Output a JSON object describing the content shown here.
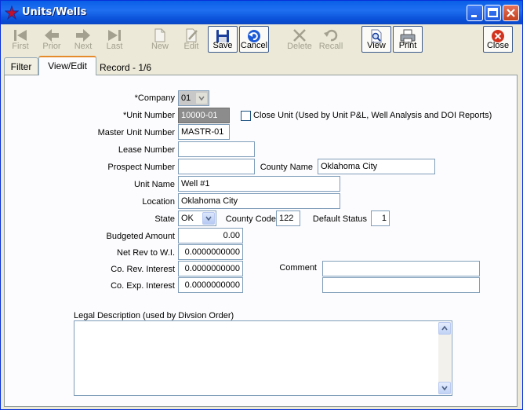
{
  "window": {
    "title": "Units/Wells"
  },
  "toolbar": {
    "first": "First",
    "prior": "Prior",
    "next": "Next",
    "last": "Last",
    "new": "New",
    "edit": "Edit",
    "save": "Save",
    "cancel": "Cancel",
    "delete": "Delete",
    "recall": "Recall",
    "view": "View",
    "print": "Print",
    "close": "Close"
  },
  "tabs": {
    "filter": "Filter",
    "view_edit": "View/Edit",
    "record_count": "Record - 1/6"
  },
  "form": {
    "company": {
      "label": "*Company",
      "value": "01"
    },
    "unit_number": {
      "label": "*Unit Number",
      "value": "10000-01"
    },
    "close_unit": {
      "label": "Close Unit (Used by Unit P&L, Well Analysis and DOI Reports)",
      "checked": false
    },
    "master_unit_number": {
      "label": "Master Unit Number",
      "value": "MASTR-01"
    },
    "lease_number": {
      "label": "Lease Number",
      "value": ""
    },
    "prospect_number": {
      "label": "Prospect Number",
      "value": ""
    },
    "county_name": {
      "label": "County Name",
      "value": "Oklahoma City"
    },
    "unit_name": {
      "label": "Unit Name",
      "value": "Well #1"
    },
    "location": {
      "label": "Location",
      "value": "Oklahoma City"
    },
    "state": {
      "label": "State",
      "value": "OK"
    },
    "county_code": {
      "label": "County Code",
      "value": "122"
    },
    "default_status": {
      "label": "Default Status",
      "value": "1"
    },
    "budgeted_amount": {
      "label": "Budgeted Amount",
      "value": "0.00"
    },
    "net_rev": {
      "label": "Net Rev to W.I.",
      "value": "0.0000000000"
    },
    "co_rev_interest": {
      "label": "Co. Rev. Interest",
      "value": "0.0000000000"
    },
    "co_exp_interest": {
      "label": "Co. Exp. Interest",
      "value": "0.0000000000"
    },
    "comment": {
      "label": "Comment",
      "line1": "",
      "line2": ""
    },
    "legal_description": {
      "label": "Legal Description (used by Divsion Order)",
      "value": ""
    }
  }
}
